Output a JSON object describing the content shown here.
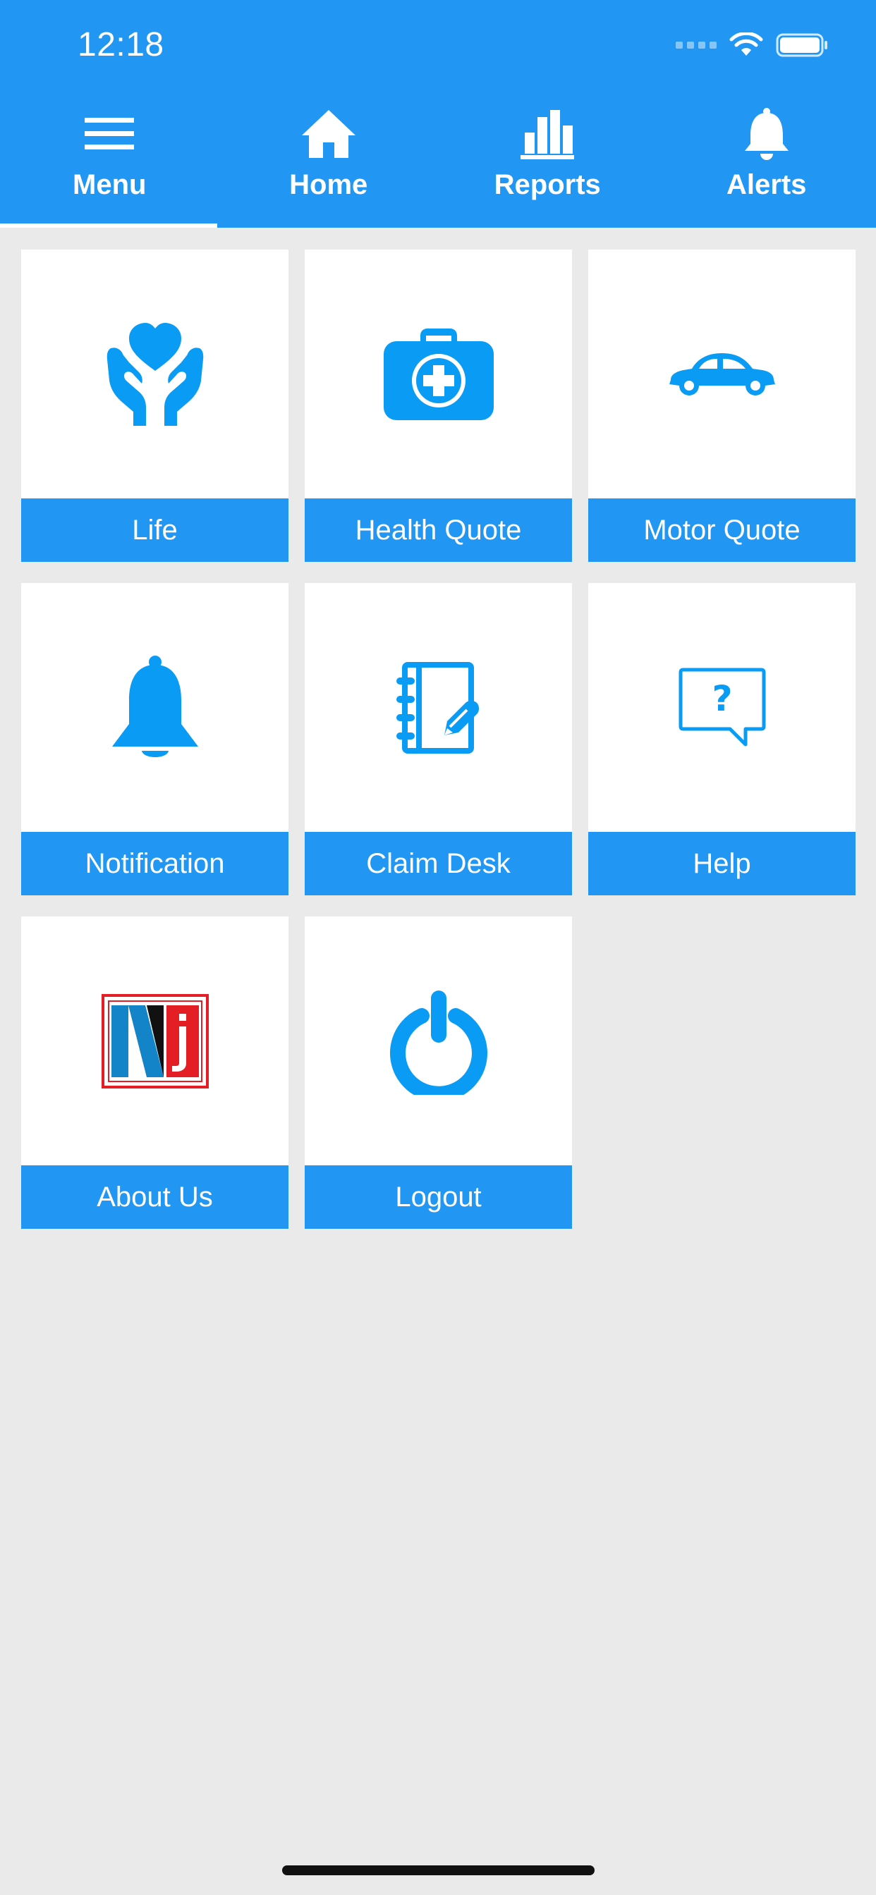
{
  "status_bar": {
    "time": "12:18"
  },
  "nav_tabs": [
    {
      "label": "Menu",
      "icon": "menu-icon",
      "active": true
    },
    {
      "label": "Home",
      "icon": "home-icon",
      "active": false
    },
    {
      "label": "Reports",
      "icon": "bar-chart-icon",
      "active": false
    },
    {
      "label": "Alerts",
      "icon": "bell-icon",
      "active": false
    }
  ],
  "tiles": [
    {
      "label": "Life",
      "icon": "heart-hands-icon"
    },
    {
      "label": "Health Quote",
      "icon": "medical-kit-icon"
    },
    {
      "label": "Motor Quote",
      "icon": "car-icon"
    },
    {
      "label": "Notification",
      "icon": "bell-icon"
    },
    {
      "label": "Claim Desk",
      "icon": "notebook-pen-icon"
    },
    {
      "label": "Help",
      "icon": "help-bubble-icon"
    },
    {
      "label": "About Us",
      "icon": "company-logo-icon"
    },
    {
      "label": "Logout",
      "icon": "power-icon"
    }
  ],
  "colors": {
    "primary": "#2196F3",
    "icon_blue": "#0A9BF5",
    "background": "#EAEAEA",
    "tile_background": "#FFFFFF",
    "logo_red": "#E31E24"
  }
}
